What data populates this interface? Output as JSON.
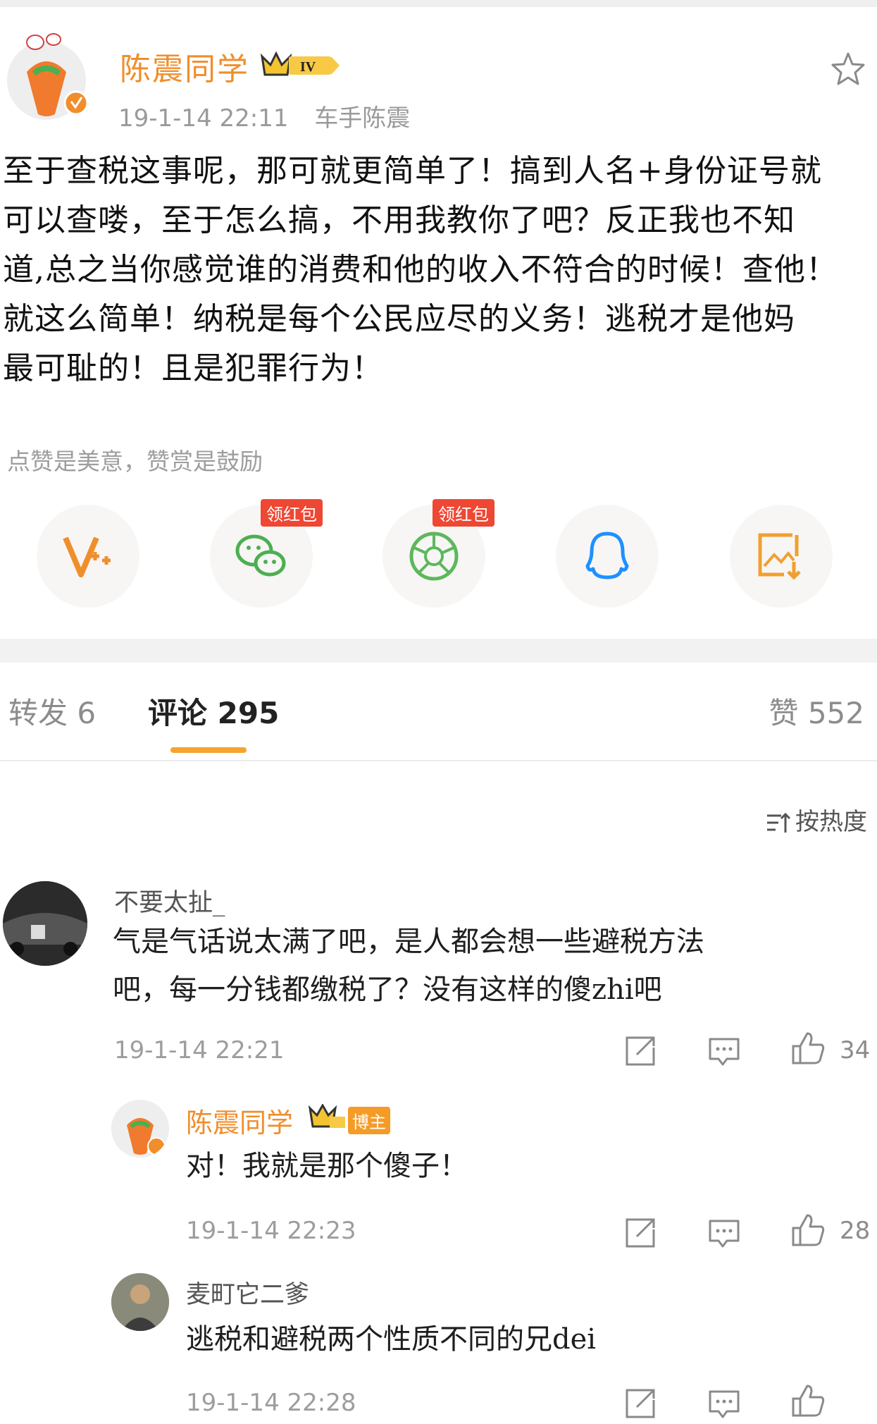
{
  "post": {
    "author": "陈震同学",
    "level_badge": "IV",
    "time": "19-1-14 22:11",
    "source": "车手陈震",
    "lines": [
      "至于查税这事呢，那可就更简单了！搞到人名+身份证号就",
      "可以查喽，至于怎么搞，不用我教你了吧？反正我也不知",
      "道,总之当你感觉谁的消费和他的收入不符合的时候！查他！",
      "就这么简单！纳税是每个公民应尽的义务！逃税才是他妈",
      "最可耻的！且是犯罪行为！"
    ],
    "tip": "点赞是美意，赞赏是鼓励"
  },
  "share": {
    "hongbao_label": "领红包",
    "buttons": [
      "vplus-icon",
      "wechat-icon",
      "moments-icon",
      "qq-icon",
      "save-image-icon"
    ]
  },
  "tabs": {
    "forward": "转发 6",
    "comments": "评论 295",
    "likes": "赞 552"
  },
  "sort_label": "按热度",
  "comments": [
    {
      "name": "不要太扯_",
      "lines": [
        "气是气话说太满了吧，是人都会想一些避税方法",
        "吧，每一分钱都缴税了？没有这样的傻zhi吧"
      ],
      "time": "19-1-14 22:21",
      "likes": "34"
    },
    {
      "name": "陈震同学",
      "badge": "博主",
      "lines": [
        "对！我就是那个傻子！"
      ],
      "time": "19-1-14 22:23",
      "likes": "28"
    },
    {
      "name": "麦町它二爹",
      "lines": [
        "逃税和避税两个性质不同的兄dei"
      ],
      "time": "19-1-14 22:28"
    }
  ],
  "colors": {
    "accent_orange": "#f08e2c",
    "tab_underline": "#f4a42c",
    "hongbao_red": "#ee4733"
  }
}
